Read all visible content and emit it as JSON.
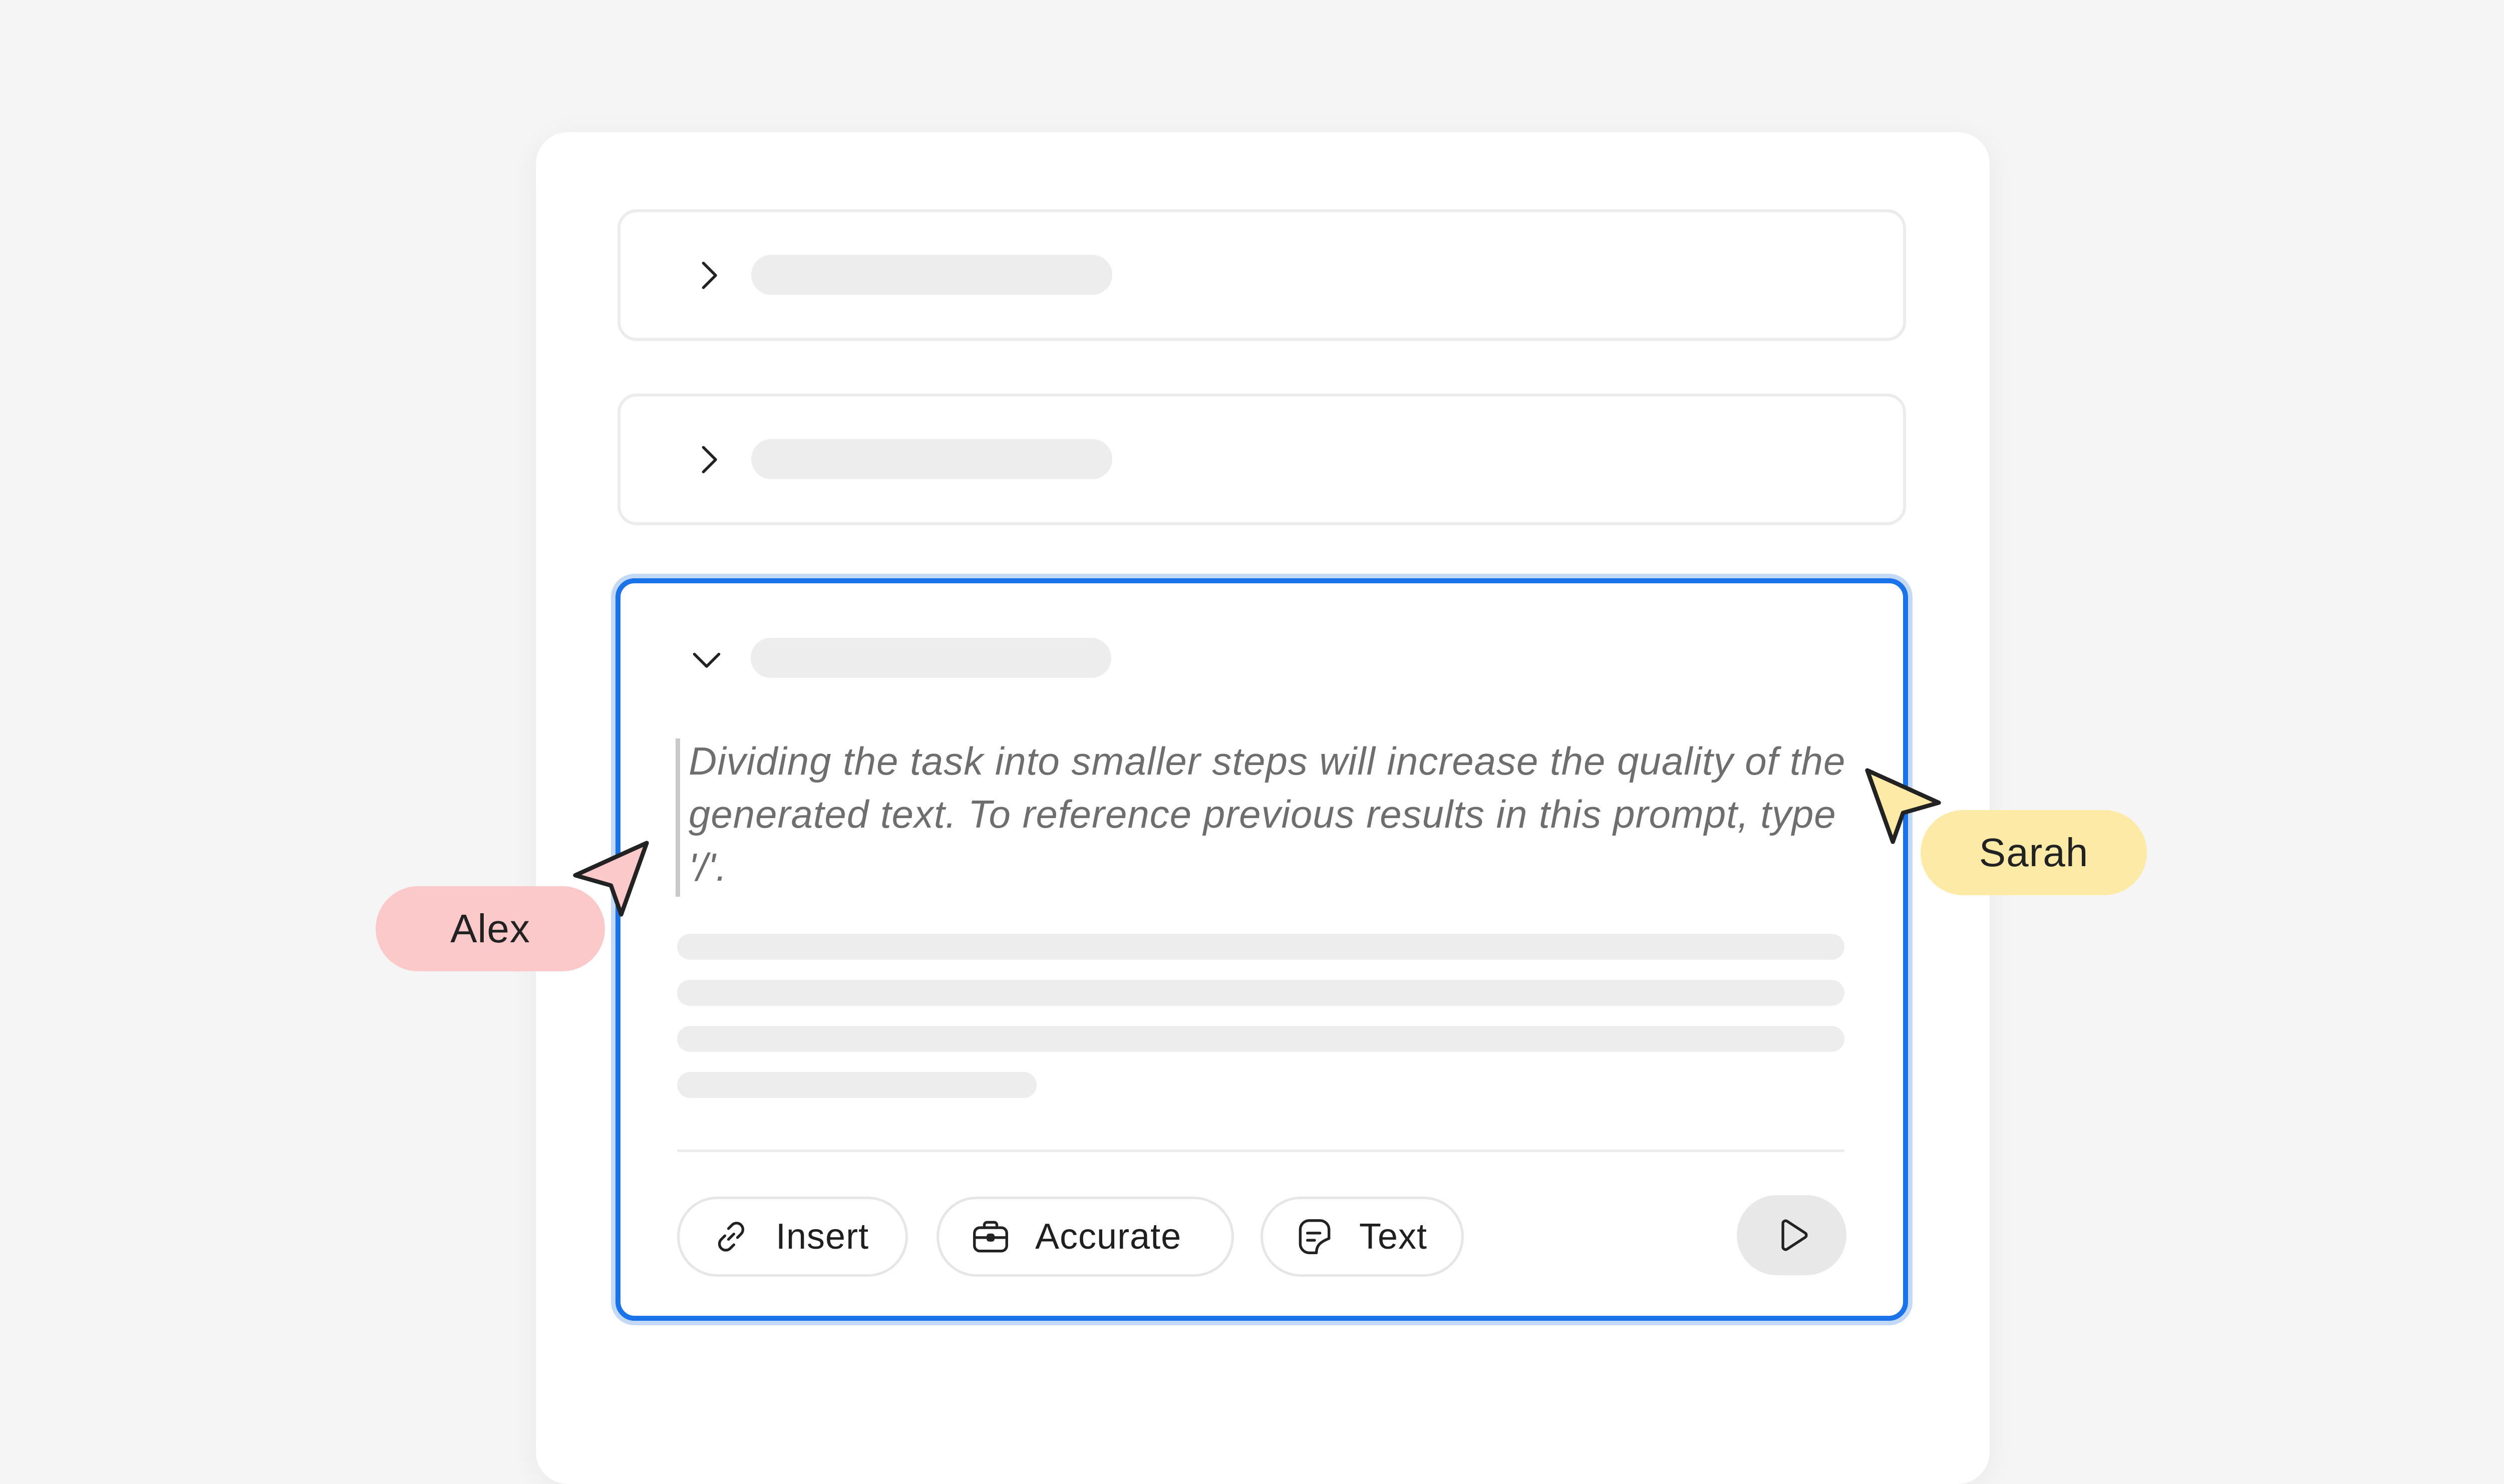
{
  "sections": [
    {
      "state": "collapsed",
      "toggle_icon": "chevron-right-icon"
    },
    {
      "state": "collapsed",
      "toggle_icon": "chevron-right-icon"
    },
    {
      "state": "expanded",
      "toggle_icon": "chevron-down-icon",
      "prompt_text": "Dividing the task into smaller steps will increase the quality of the generated text. To reference previous results in this prompt, type '/'.",
      "toolbar": {
        "insert_label": "Insert",
        "insert_icon": "link-icon",
        "accurate_label": "Accurate",
        "accurate_icon": "briefcase-icon",
        "text_label": "Text",
        "text_icon": "document-icon",
        "run_icon": "play-icon"
      }
    }
  ],
  "collaborators": [
    {
      "name": "Alex",
      "color": "#fbc9c9"
    },
    {
      "name": "Sarah",
      "color": "#fdeaa6"
    }
  ],
  "colors": {
    "focus_border": "#1a73e8",
    "placeholder": "#ededed",
    "background": "#f5f5f5"
  }
}
